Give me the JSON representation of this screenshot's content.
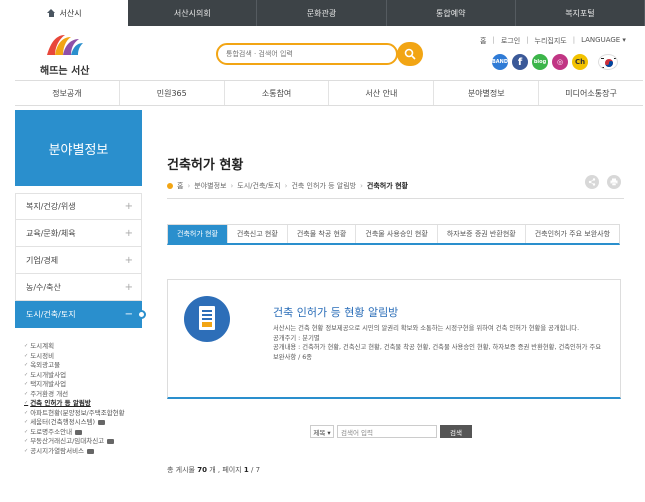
{
  "topbar": {
    "tabs": [
      "서산시",
      "서산시의회",
      "문화관광",
      "통합예약",
      "복지포털"
    ]
  },
  "header": {
    "logo_text": "해뜨는 서산",
    "search_placeholder": "통합검색 · 검색어 입력",
    "util_links": [
      "홈",
      "로그인",
      "누리집지도",
      "LANGUAGE ▾"
    ],
    "social": [
      {
        "name": "band",
        "label": "BAND",
        "color": "#2f7bd6"
      },
      {
        "name": "facebook",
        "label": "f",
        "color": "#3b5998"
      },
      {
        "name": "blog",
        "label": "blog",
        "color": "#3cb54a"
      },
      {
        "name": "instagram",
        "label": "◎",
        "color": "#c13584"
      },
      {
        "name": "kakao",
        "label": "Ch",
        "color": "#f2c200"
      }
    ]
  },
  "gnb": [
    "정보공개",
    "민원365",
    "소통참여",
    "서산 안내",
    "분야별정보",
    "미디어소통장구"
  ],
  "lnb": {
    "title": "분야별정보",
    "items": [
      "복지/건강/위생",
      "교육/문화/체육",
      "기업/경제",
      "농/수/축산",
      "도시/건축/토지"
    ],
    "active_minus": "−",
    "plus": "+",
    "sub_items": [
      {
        "label": "도시계획",
        "lock": false
      },
      {
        "label": "도시정비",
        "lock": false
      },
      {
        "label": "옥외광고물",
        "lock": false
      },
      {
        "label": "도시개발사업",
        "lock": false
      },
      {
        "label": "택지개발사업",
        "lock": false
      },
      {
        "label": "주거환경 개선",
        "lock": false
      },
      {
        "label": "건축 인허가 등 알림방",
        "lock": false
      },
      {
        "label": "아파트현황(분양정보/주택조합현황",
        "lock": false
      },
      {
        "label": "세움터(건축행정시스템)",
        "lock": true
      },
      {
        "label": "도로명주소안내",
        "lock": true
      },
      {
        "label": "부동산거래신고/임대차신고",
        "lock": true
      },
      {
        "label": "공시지가열람서비스",
        "lock": true
      }
    ]
  },
  "content": {
    "title": "건축허가 현황",
    "breadcrumb": [
      "홈",
      "분야별정보",
      "도시/건축/토지",
      "건축 인허가 등 알림방",
      "건축허가 현황"
    ],
    "tabs": [
      "건축허가 현황",
      "건축신고 현황",
      "건축물 착공 현황",
      "건축물 사용승인 현황",
      "하자보증 증권 반환현황",
      "건축인허가 주요 보완사항"
    ],
    "board": {
      "heading": "건축 인허가 등 현황 알림방",
      "desc": "서산시는 건축 현황 정보제공으로 시민의 알권리 확보와 소통하는 시정구현을 위하여 건축 인허가 현황을 공개합니다.",
      "cycle": "공개주기 : 분기별",
      "contents": "공개내용 : 건축허가 현황, 건축신고 현황, 건축물 착공 현황, 건축물 사용승인 현황, 하자보증 증권 반환현황, 건축인허가 주요 보완사항 / 6종"
    },
    "search": {
      "select": "제목 ▾",
      "placeholder": "검색어 입력",
      "button": "검색"
    },
    "count": {
      "prefix": "총 게시물",
      "total": "70",
      "unit": "개 ,",
      "page_prefix": "페이지",
      "page": "1",
      "page_total": "/ 7"
    }
  }
}
